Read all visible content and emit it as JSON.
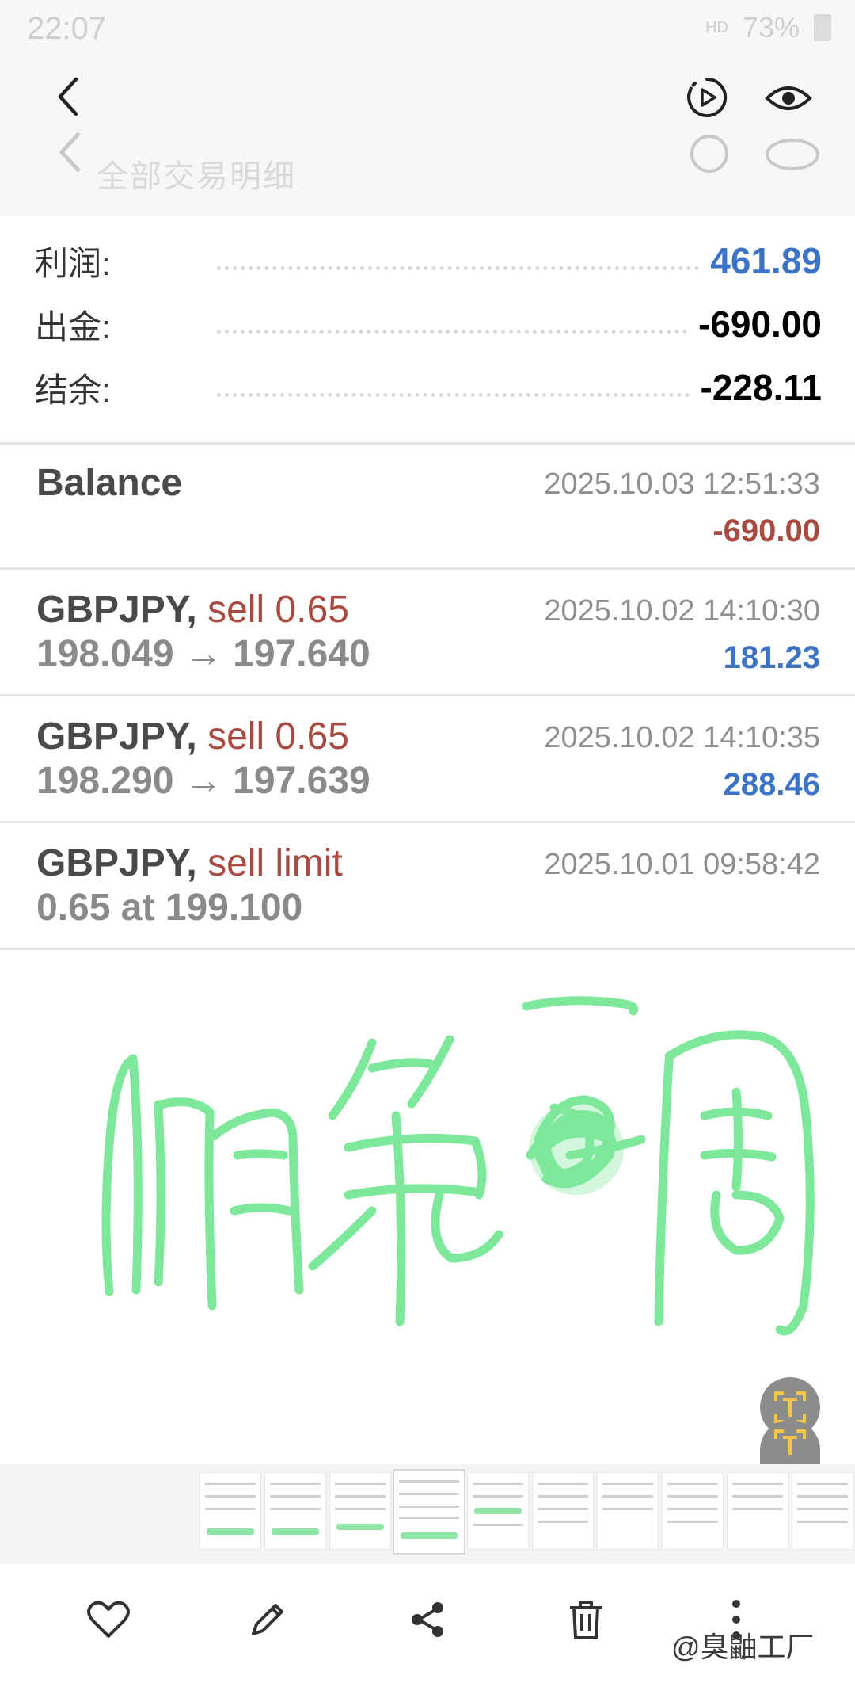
{
  "status_bar": {
    "time": "22:07",
    "hd": "HD",
    "battery": "73%"
  },
  "header": {
    "ghost_title": "全部交易明细"
  },
  "summary": [
    {
      "label": "利润:",
      "value": "461.89",
      "color": "#3d73c6"
    },
    {
      "label": "出金:",
      "value": "-690.00",
      "color": "#000000"
    },
    {
      "label": "结余:",
      "value": "-228.11",
      "color": "#000000"
    }
  ],
  "deals": [
    {
      "symbol": "Balance",
      "action": "",
      "line2": "",
      "time": "2025.10.03 12:51:33",
      "amount": "-690.00",
      "sign": "neg"
    },
    {
      "symbol": "GBPJPY,",
      "action": "sell 0.65",
      "line2": "198.049 → 197.640",
      "time": "2025.10.02 14:10:30",
      "amount": "181.23",
      "sign": "pos"
    },
    {
      "symbol": "GBPJPY,",
      "action": "sell 0.65",
      "line2": "198.290 → 197.639",
      "time": "2025.10.02 14:10:35",
      "amount": "288.46",
      "sign": "pos"
    },
    {
      "symbol": "GBPJPY,",
      "action": "sell limit",
      "line2": "0.65 at 199.100",
      "time": "2025.10.01 09:58:42",
      "amount": "",
      "sign": ""
    }
  ],
  "colors": {
    "handwriting": "#7ee89a",
    "profit": "#3d73c6",
    "loss": "#a84a40"
  },
  "icons": {
    "back": "chevron-left-icon",
    "motion": "motion-photo-icon",
    "view": "eye-icon",
    "text_extract": "text-extract-icon",
    "favorite": "heart-icon",
    "edit": "pencil-icon",
    "share": "share-icon",
    "delete": "trash-icon",
    "more": "more-icon"
  },
  "watermark": "@臭鼬工厂"
}
